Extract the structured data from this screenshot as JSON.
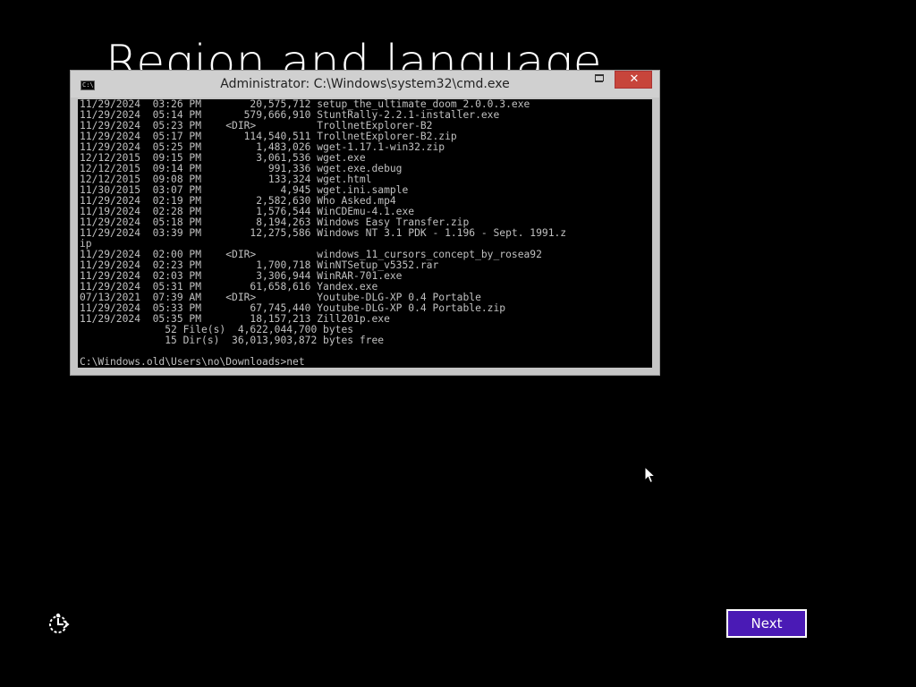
{
  "background": {
    "heading": "Region and language"
  },
  "cmd_window": {
    "title": "Administrator: C:\\Windows\\system32\\cmd.exe",
    "icon": "cmd-icon",
    "icon_text": "C:\\",
    "controls": {
      "minimize_icon": "minimize-icon",
      "maximize_icon": "maximize-icon",
      "close_label": "✕",
      "close_color": "#c7453b"
    },
    "console_lines": [
      "11/29/2024  03:26 PM        20,575,712 setup_the_ultimate_doom_2.0.0.3.exe",
      "11/29/2024  05:14 PM       579,666,910 StuntRally-2.2.1-installer.exe",
      "11/29/2024  05:23 PM    <DIR>          TrollnetExplorer-B2",
      "11/29/2024  05:17 PM       114,540,511 TrollnetExplorer-B2.zip",
      "11/29/2024  05:25 PM         1,483,026 wget-1.17.1-win32.zip",
      "12/12/2015  09:15 PM         3,061,536 wget.exe",
      "12/12/2015  09:14 PM           991,336 wget.exe.debug",
      "12/12/2015  09:08 PM           133,324 wget.html",
      "11/30/2015  03:07 PM             4,945 wget.ini.sample",
      "11/29/2024  02:19 PM         2,582,630 Who Asked.mp4",
      "11/19/2024  02:28 PM         1,576,544 WinCDEmu-4.1.exe",
      "11/29/2024  05:18 PM         8,194,263 Windows Easy Transfer.zip",
      "11/29/2024  03:39 PM        12,275,586 Windows NT 3.1 PDK - 1.196 - Sept. 1991.z",
      "ip",
      "11/29/2024  02:00 PM    <DIR>          windows_11_cursors_concept_by_rosea92",
      "11/29/2024  02:23 PM         1,700,718 WinNTSetup_v5352.rar",
      "11/29/2024  02:03 PM         3,306,944 WinRAR-701.exe",
      "11/29/2024  05:31 PM        61,658,616 Yandex.exe",
      "07/13/2021  07:39 AM    <DIR>          Youtube-DLG-XP 0.4 Portable",
      "11/29/2024  05:33 PM        67,745,440 Youtube-DLG-XP 0.4 Portable.zip",
      "11/29/2024  05:35 PM        18,157,213 Zill201p.exe",
      "              52 File(s)  4,622,044,700 bytes",
      "              15 Dir(s)  36,013,903,872 bytes free",
      "",
      "C:\\Windows.old\\Users\\no\\Downloads>net"
    ]
  },
  "footer": {
    "ease_of_access_icon": "ease-of-access-icon",
    "next_label": "Next",
    "next_color": "#4a1ab5"
  },
  "pointer": {
    "icon": "mouse-pointer-icon"
  }
}
